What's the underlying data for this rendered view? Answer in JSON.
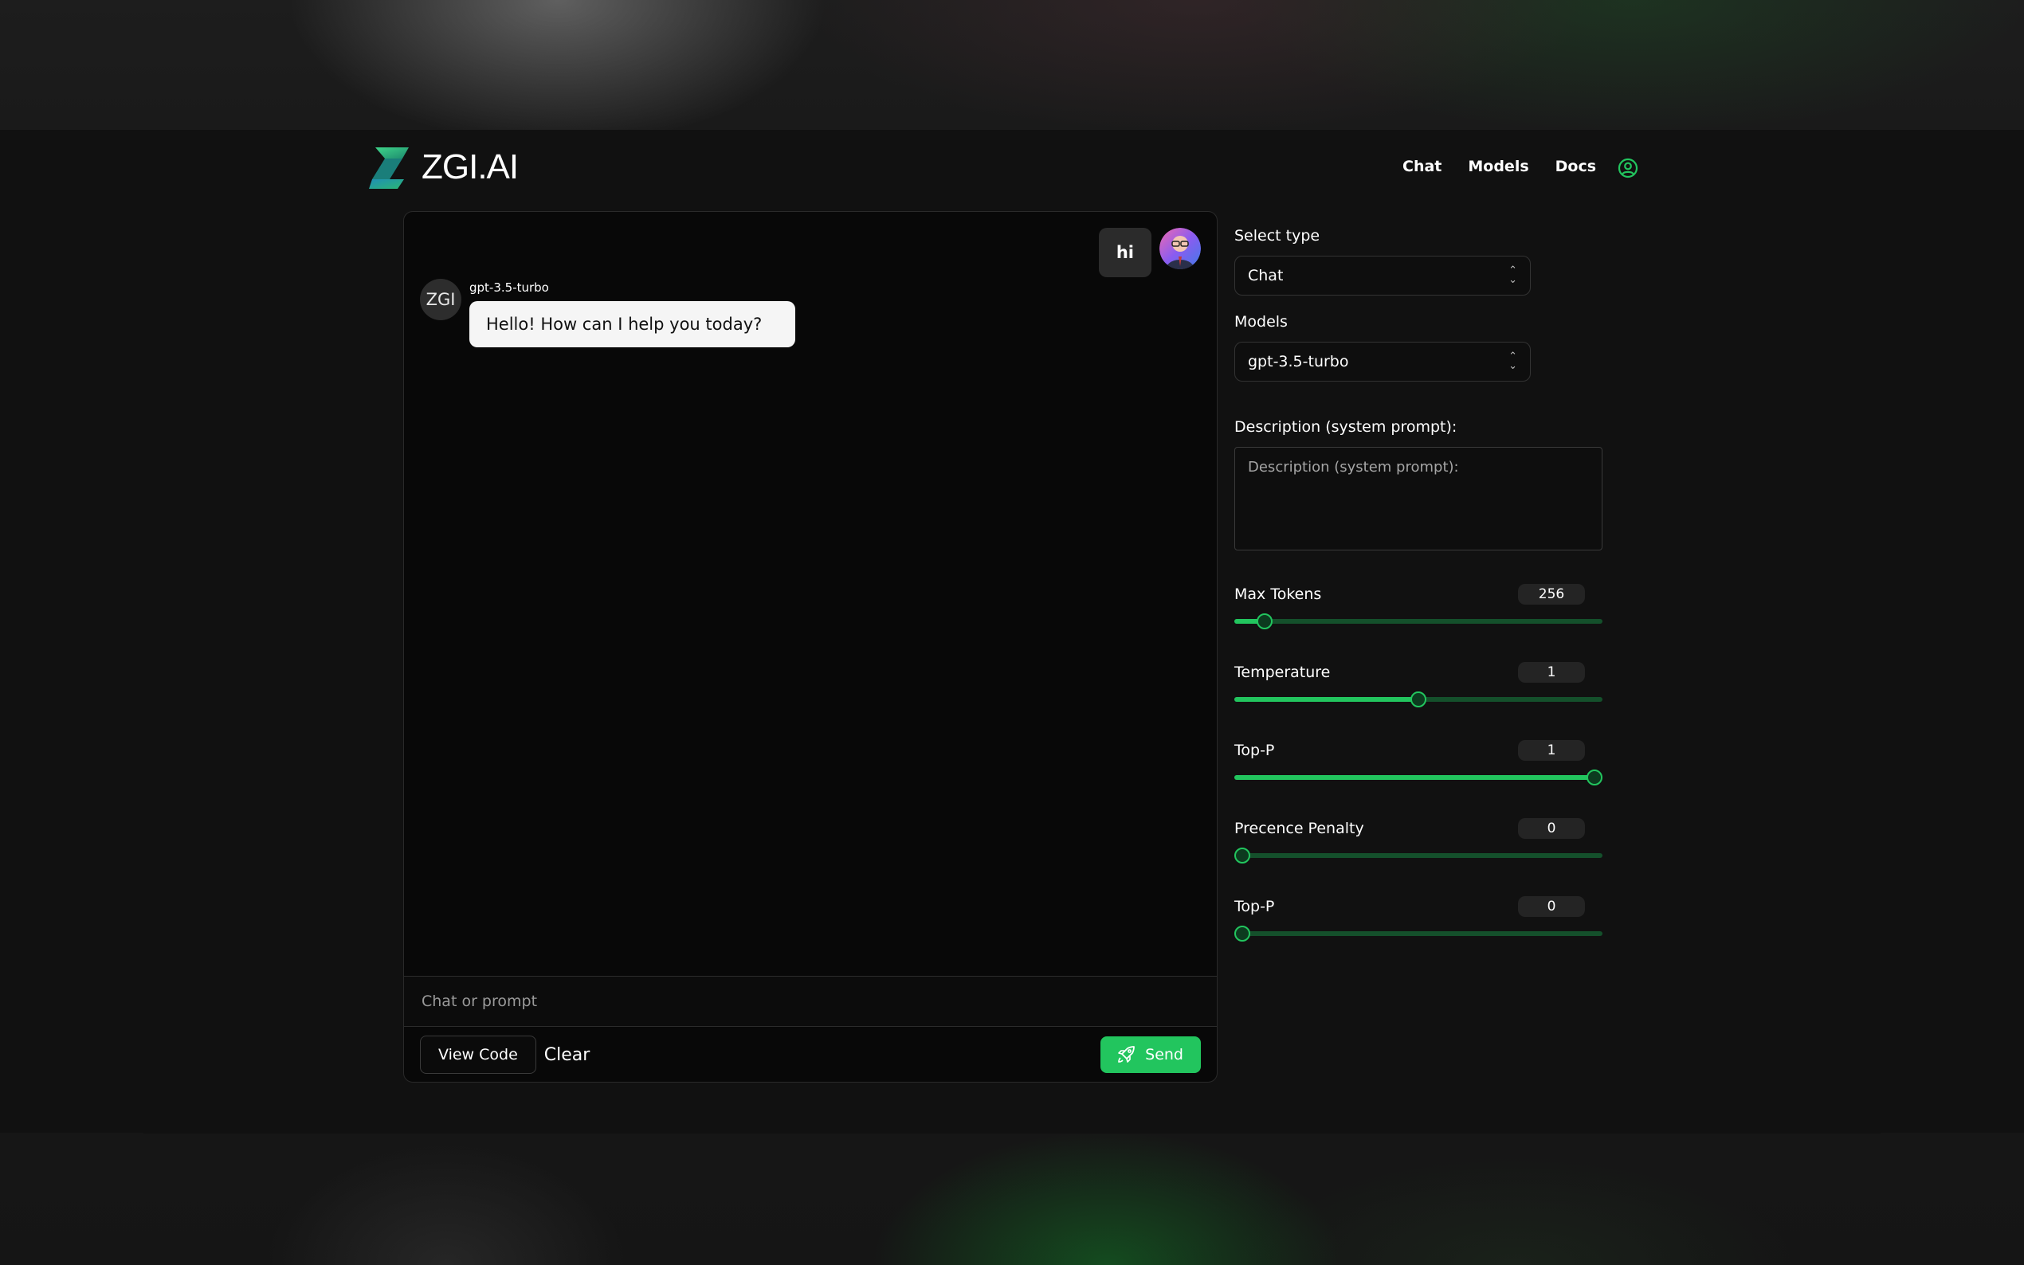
{
  "brand": {
    "name": "ZGI.AI"
  },
  "nav": {
    "chat": "Chat",
    "models": "Models",
    "docs": "Docs"
  },
  "chat": {
    "user_message": "hi",
    "bot_avatar_text": "ZGI",
    "bot_model": "gpt-3.5-turbo",
    "bot_message": "Hello! How can I help you today?",
    "input_placeholder": "Chat or prompt",
    "view_code_label": "View Code",
    "clear_label": "Clear",
    "send_label": "Send"
  },
  "settings": {
    "select_type_label": "Select type",
    "select_type_value": "Chat",
    "models_label": "Models",
    "models_value": "gpt-3.5-turbo",
    "description_label": "Description (system prompt):",
    "description_placeholder": "Description (system prompt):",
    "sliders": [
      {
        "label": "Max Tokens",
        "value": "256",
        "fraction": 0.082
      },
      {
        "label": "Temperature",
        "value": "1",
        "fraction": 0.5
      },
      {
        "label": "Top-P",
        "value": "1",
        "fraction": 0.978
      },
      {
        "label": "Precence Penalty",
        "value": "0",
        "fraction": 0.022
      },
      {
        "label": "Top-P",
        "value": "0",
        "fraction": 0.022
      }
    ]
  },
  "colors": {
    "accent": "#22c55e",
    "track": "#14502b",
    "background": "#111111"
  }
}
